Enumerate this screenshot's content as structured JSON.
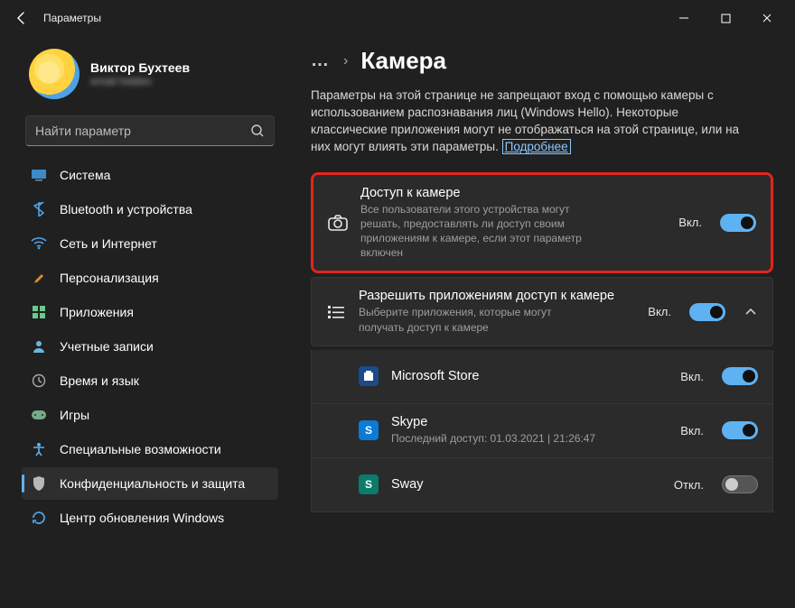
{
  "window": {
    "title": "Параметры"
  },
  "profile": {
    "name": "Виктор Бухтеев",
    "email": "email hidden"
  },
  "search": {
    "placeholder": "Найти параметр"
  },
  "nav": {
    "items": [
      {
        "label": "Система"
      },
      {
        "label": "Bluetooth и устройства"
      },
      {
        "label": "Сеть и Интернет"
      },
      {
        "label": "Персонализация"
      },
      {
        "label": "Приложения"
      },
      {
        "label": "Учетные записи"
      },
      {
        "label": "Время и язык"
      },
      {
        "label": "Игры"
      },
      {
        "label": "Специальные возможности"
      },
      {
        "label": "Конфиденциальность и защита"
      },
      {
        "label": "Центр обновления Windows"
      }
    ]
  },
  "page": {
    "title": "Камера",
    "intro": "Параметры на этой странице не запрещают вход с помощью камеры с использованием распознавания лиц (Windows Hello). Некоторые классические приложения могут не отображаться на этой странице, или на них могут влиять эти параметры.",
    "learn_more": "Подробнее"
  },
  "camera_access": {
    "title": "Доступ к камере",
    "subtitle": "Все пользователи этого устройства могут решать, предоставлять ли доступ своим приложениям к камере, если этот параметр включен",
    "state": "Вкл."
  },
  "app_access": {
    "title": "Разрешить приложениям доступ к камере",
    "subtitle": "Выберите приложения, которые могут получать доступ к камере",
    "state": "Вкл."
  },
  "apps": [
    {
      "name": "Microsoft Store",
      "state": "Вкл.",
      "on": true,
      "sub": ""
    },
    {
      "name": "Skype",
      "state": "Вкл.",
      "on": true,
      "sub": "Последний доступ: 01.03.2021  |  21:26:47"
    },
    {
      "name": "Sway",
      "state": "Откл.",
      "on": false,
      "sub": ""
    }
  ]
}
